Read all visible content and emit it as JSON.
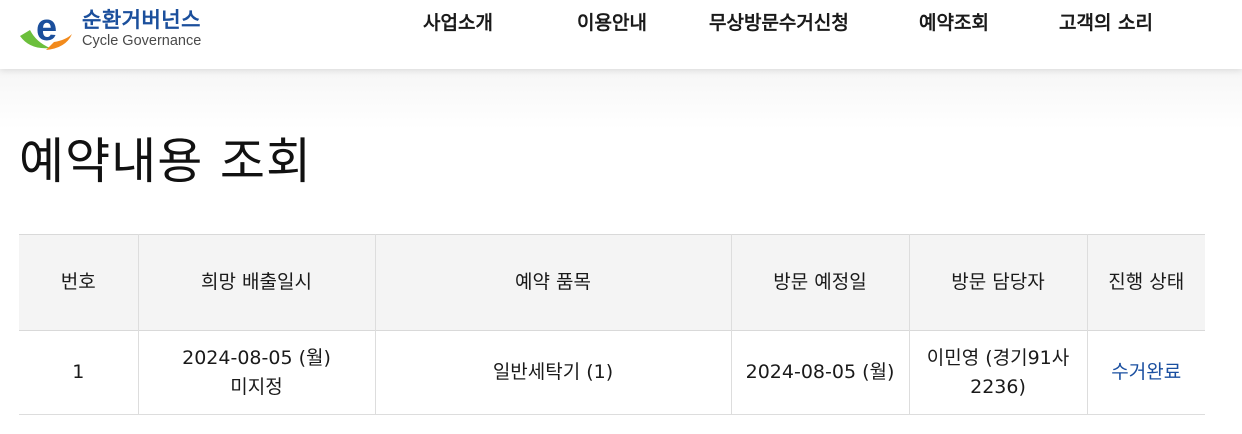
{
  "brand": {
    "title": "순환거버넌스",
    "subtitle": "Cycle Governance",
    "logo_letter": "e",
    "colors": {
      "blue": "#1b4f9c",
      "green": "#6cbf3c",
      "orange": "#f28a1c"
    }
  },
  "nav": {
    "items": [
      {
        "label": "사업소개"
      },
      {
        "label": "이용안내"
      },
      {
        "label": "무상방문수거신청"
      },
      {
        "label": "예약조회"
      },
      {
        "label": "고객의 소리"
      }
    ]
  },
  "page": {
    "title": "예약내용 조회"
  },
  "table": {
    "headers": [
      "번호",
      "희망 배출일시",
      "예약 품목",
      "방문 예정일",
      "방문 담당자",
      "진행 상태"
    ],
    "rows": [
      {
        "no": "1",
        "desired_date": "2024-08-05 (월)",
        "desired_time": "미지정",
        "item": "일반세탁기 (1)",
        "visit_date": "2024-08-05 (월)",
        "staff": "이민영 (경기91사2236)",
        "status": "수거완료"
      }
    ]
  },
  "colors": {
    "status_link": "#1a4fa0",
    "header_bg": "#f4f4f4"
  }
}
